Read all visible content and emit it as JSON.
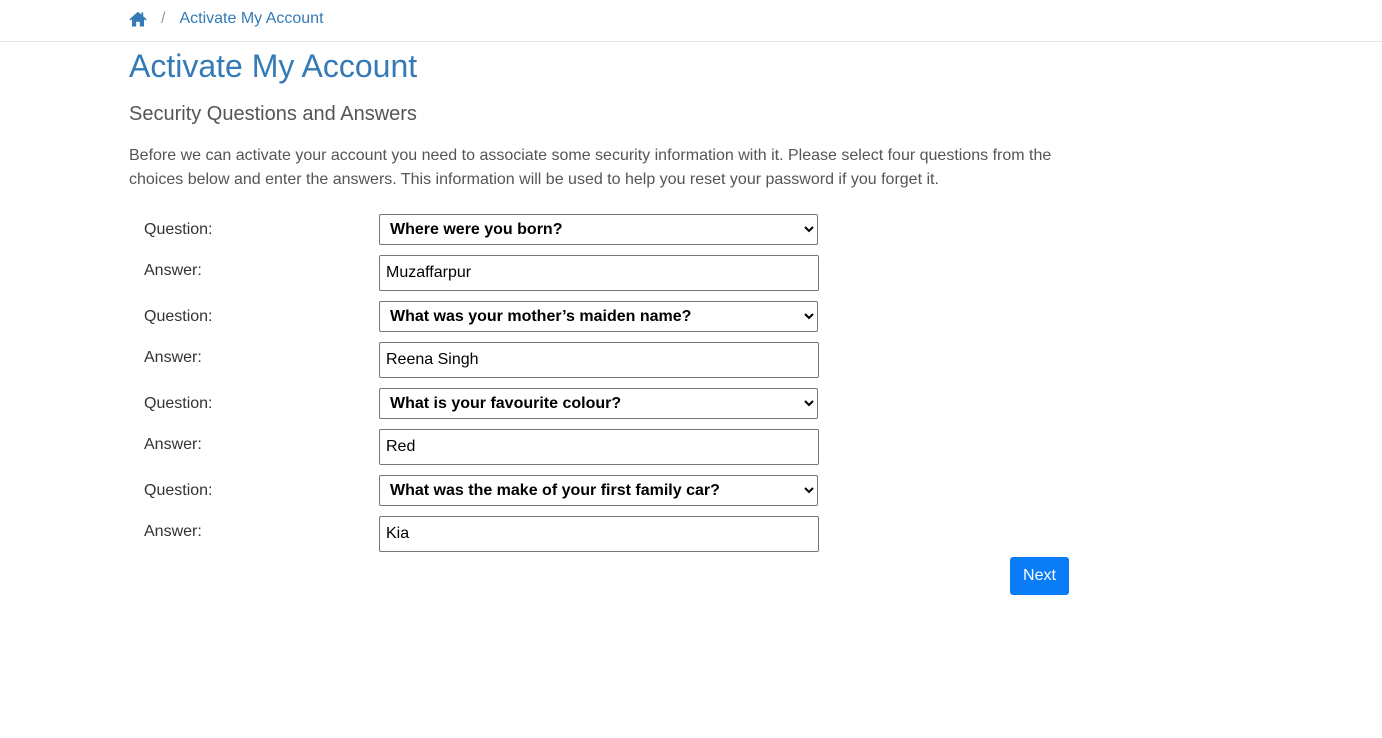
{
  "breadcrumb": {
    "separator": "/",
    "current": "Activate My Account"
  },
  "page": {
    "title": "Activate My Account",
    "subtitle": "Security Questions and Answers",
    "intro": "Before we can activate your account you need to associate some security information with it. Please select four questions from the choices below and enter the answers. This information will be used to help you reset your password if you forget it."
  },
  "form": {
    "question_label": "Question:",
    "answer_label": "Answer:",
    "rows": [
      {
        "question": "Where were you born?",
        "answer": "Muzaffarpur"
      },
      {
        "question": "What was your mother’s maiden name?",
        "answer": "Reena Singh"
      },
      {
        "question": "What is your favourite colour?",
        "answer": "Red"
      },
      {
        "question": "What was the make of your first family car?",
        "answer": "Kia"
      }
    ],
    "next_label": "Next"
  },
  "colors": {
    "link": "#337ab7",
    "primary_button": "#0a7cf5",
    "text": "#555555"
  },
  "icons": {
    "home": "home-icon"
  }
}
